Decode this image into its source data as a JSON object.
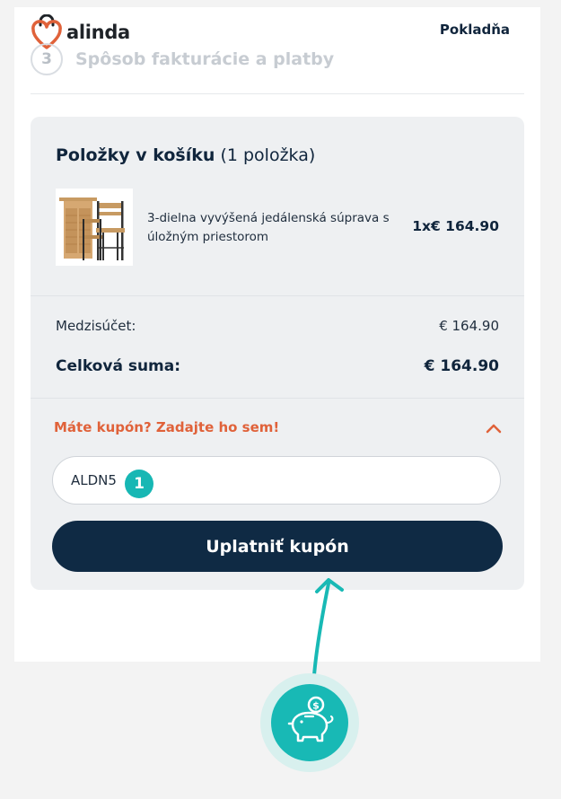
{
  "header": {
    "logo_text": "alinda",
    "checkout_link": "Pokladňa",
    "step_number": "3",
    "step_title": "Spôsob fakturácie a platby"
  },
  "cart": {
    "title_bold": "Položky v košíku",
    "title_count": "(1 položka)",
    "items": [
      {
        "name": "3-dielna vyvýšená jedálenská súprava s úložným priestorom",
        "price": "1x€ 164.90"
      }
    ]
  },
  "totals": {
    "subtotal_label": "Medzisúčet:",
    "subtotal_value": "€ 164.90",
    "total_label": "Celková suma:",
    "total_value": "€ 164.90"
  },
  "coupon": {
    "toggle_label": "Máte kupón? Zadajte ho sem!",
    "input_value": "ALDN5",
    "apply_label": "Uplatniť kupón",
    "step_marker": "1"
  },
  "colors": {
    "accent_orange": "#e0623a",
    "navy": "#0f2a44",
    "teal": "#18b9b5"
  },
  "icons": {
    "logo": "shopping-bag-heart-icon",
    "chevron": "chevron-up-icon",
    "piggy": "piggy-bank-coin-icon"
  }
}
